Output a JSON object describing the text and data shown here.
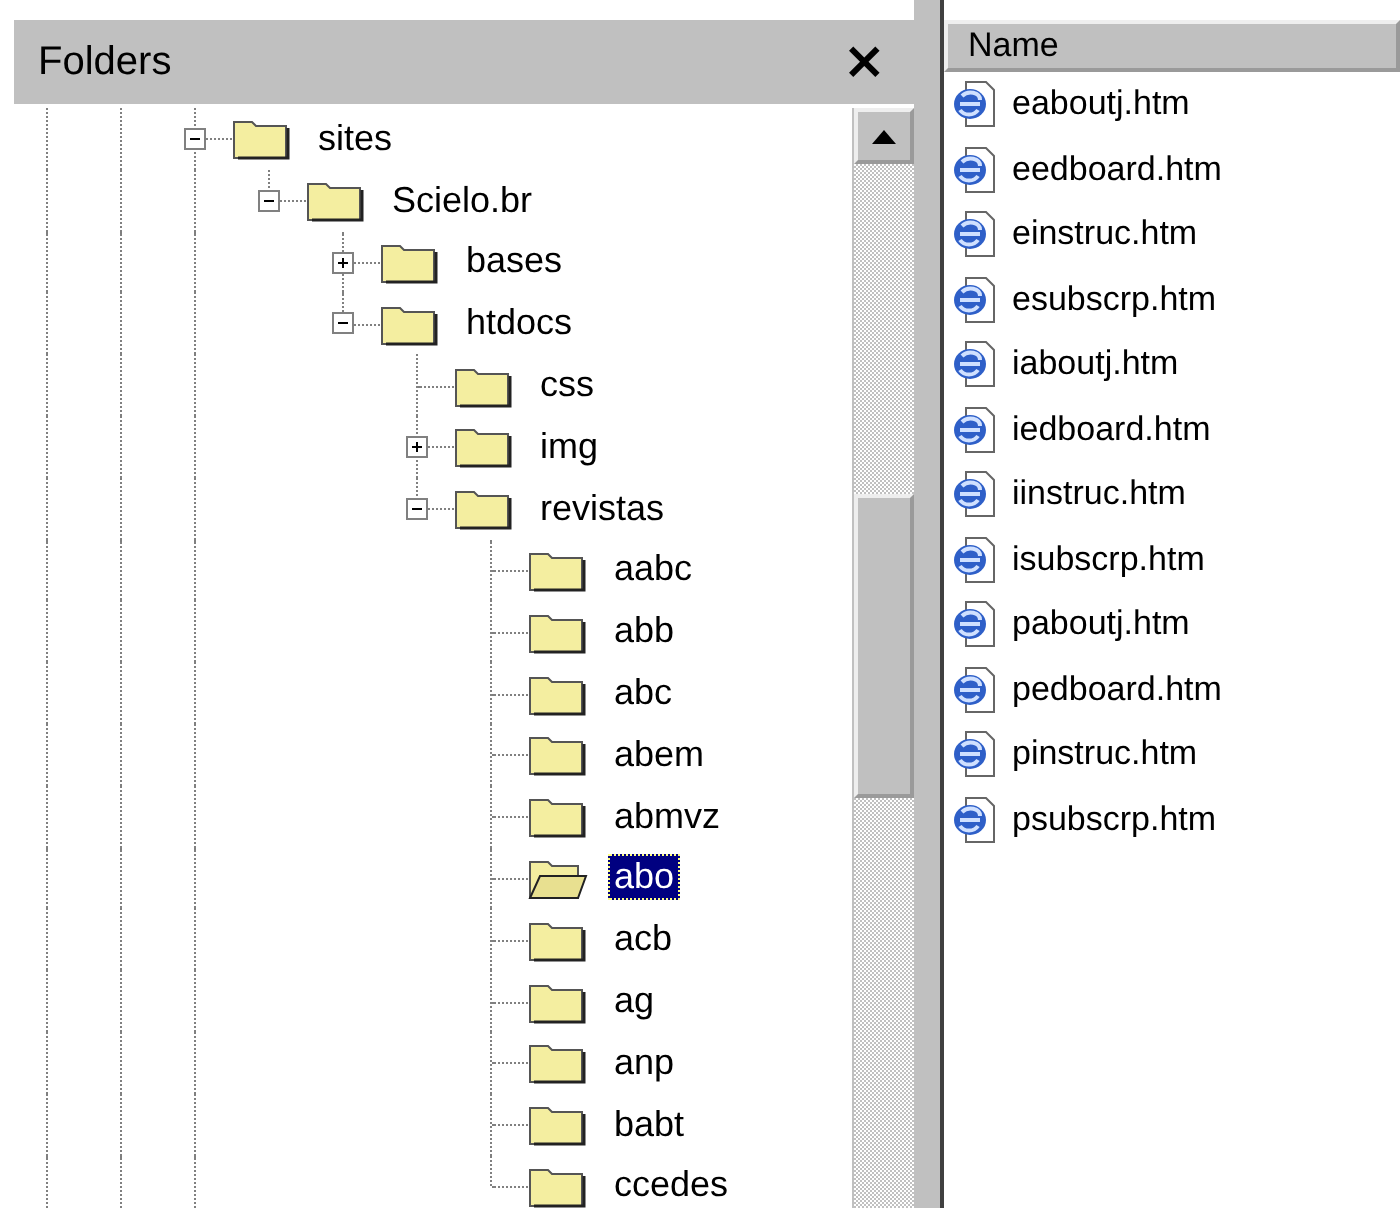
{
  "folders_pane": {
    "title": "Folders",
    "close": "×"
  },
  "tree": [
    {
      "label": "sites",
      "expanded": true,
      "selected": false,
      "children": [
        {
          "label": "Scielo.br",
          "expanded": true,
          "selected": false,
          "children": [
            {
              "label": "bases",
              "expanded": false,
              "selected": false
            },
            {
              "label": "htdocs",
              "expanded": true,
              "selected": false,
              "children": [
                {
                  "label": "css",
                  "selected": false
                },
                {
                  "label": "img",
                  "expanded": false,
                  "selected": false
                },
                {
                  "label": "revistas",
                  "expanded": true,
                  "selected": false,
                  "children": [
                    {
                      "label": "aabc",
                      "selected": false
                    },
                    {
                      "label": "abb",
                      "selected": false
                    },
                    {
                      "label": "abc",
                      "selected": false
                    },
                    {
                      "label": "abem",
                      "selected": false
                    },
                    {
                      "label": "abmvz",
                      "selected": false
                    },
                    {
                      "label": "abo",
                      "selected": true
                    },
                    {
                      "label": "acb",
                      "selected": false
                    },
                    {
                      "label": "ag",
                      "selected": false
                    },
                    {
                      "label": "anp",
                      "selected": false
                    },
                    {
                      "label": "babt",
                      "selected": false
                    },
                    {
                      "label": "ccedes",
                      "selected": false
                    }
                  ]
                }
              ]
            }
          ]
        }
      ]
    }
  ],
  "file_list": {
    "columns": [
      "Name"
    ],
    "files": [
      "eaboutj.htm",
      "eedboard.htm",
      "einstruc.htm",
      "esubscrp.htm",
      "iaboutj.htm",
      "iedboard.htm",
      "iinstruc.htm",
      "isubscrp.htm",
      "paboutj.htm",
      "pedboard.htm",
      "pinstruc.htm",
      "psubscrp.htm"
    ]
  }
}
